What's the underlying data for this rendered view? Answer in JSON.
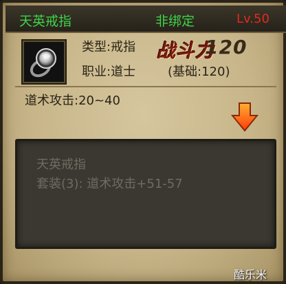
{
  "header": {
    "item_name": "天英戒指",
    "bind_status": "非绑定",
    "level": "Lv.50"
  },
  "item": {
    "icon": "ring-icon",
    "type": "类型:戒指",
    "career": "职业:道士",
    "power_label": "战斗力",
    "power_value": "120",
    "base": "(基础:120)",
    "attack": "道术攻击:20~40"
  },
  "set": {
    "name": "天英戒指",
    "desc": "套装(3): 道术攻击+51-57"
  },
  "watermark": "酷乐米",
  "colors": {
    "header_green": "#3fd24a",
    "level_red": "#e02a1e",
    "arrow_orange": "#ff5a14"
  }
}
